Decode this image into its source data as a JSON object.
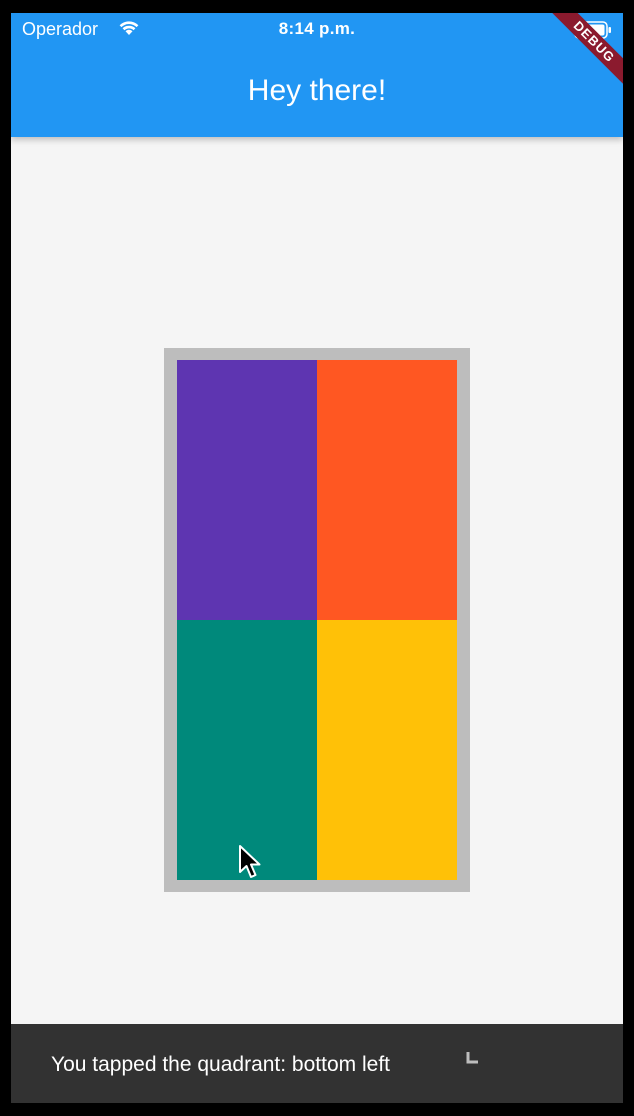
{
  "status_bar": {
    "carrier": "Operador",
    "time": "8:14 p.m.",
    "wifi_icon": "wifi-icon",
    "battery_icon": "battery-icon"
  },
  "app_bar": {
    "title": "Hey there!",
    "background_color": "#2196f3"
  },
  "debug_banner": {
    "label": "DEBUG"
  },
  "quadrants": {
    "top_left": {
      "color": "#5e35b1"
    },
    "top_right": {
      "color": "#ff5722"
    },
    "bottom_left": {
      "color": "#00897b"
    },
    "bottom_right": {
      "color": "#ffc107"
    },
    "frame_color": "#bdbdbd"
  },
  "snackbar": {
    "message": "You tapped the quadrant: bottom left"
  }
}
